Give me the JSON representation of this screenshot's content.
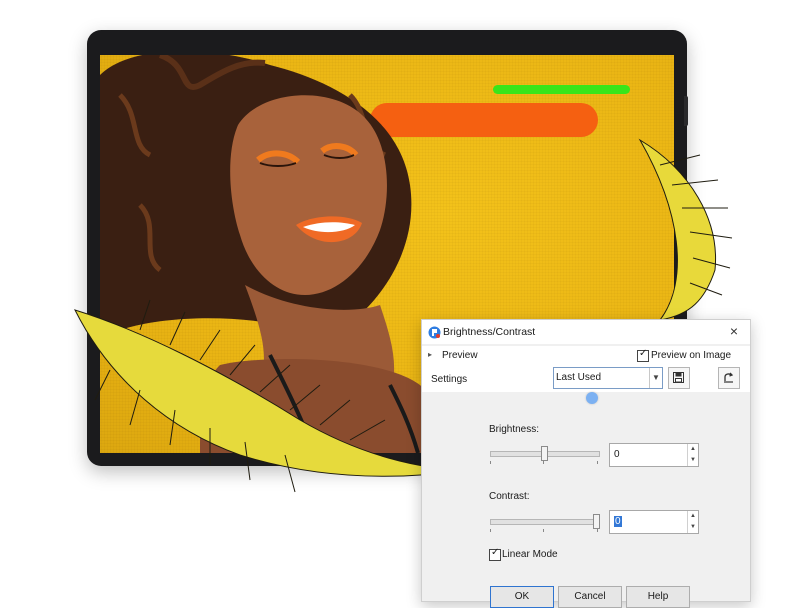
{
  "dialog": {
    "title": "Brightness/Contrast",
    "close_glyph": "×",
    "preview_label": "Preview",
    "preview_on_image_label": "Preview on Image",
    "preview_on_image_checked": true,
    "settings_label": "Settings",
    "settings_value": "Last Used",
    "brightness_label": "Brightness:",
    "brightness_value": "0",
    "contrast_label": "Contrast:",
    "contrast_value": "0",
    "linear_mode_label": "Linear Mode",
    "linear_mode_checked": true,
    "buttons": {
      "ok": "OK",
      "cancel": "Cancel",
      "help": "Help"
    }
  },
  "colors": {
    "background_yellow": "#eab514",
    "bar_green": "#39e51a",
    "bar_orange": "#f56011",
    "selection_blue": "#3378d6",
    "marker_blue": "#7cb1f2"
  },
  "icons": {
    "app": "paintshop-icon",
    "close": "close-icon",
    "save": "save-preset-icon",
    "reset": "reset-icon",
    "dropdown": "chevron-down-icon"
  }
}
